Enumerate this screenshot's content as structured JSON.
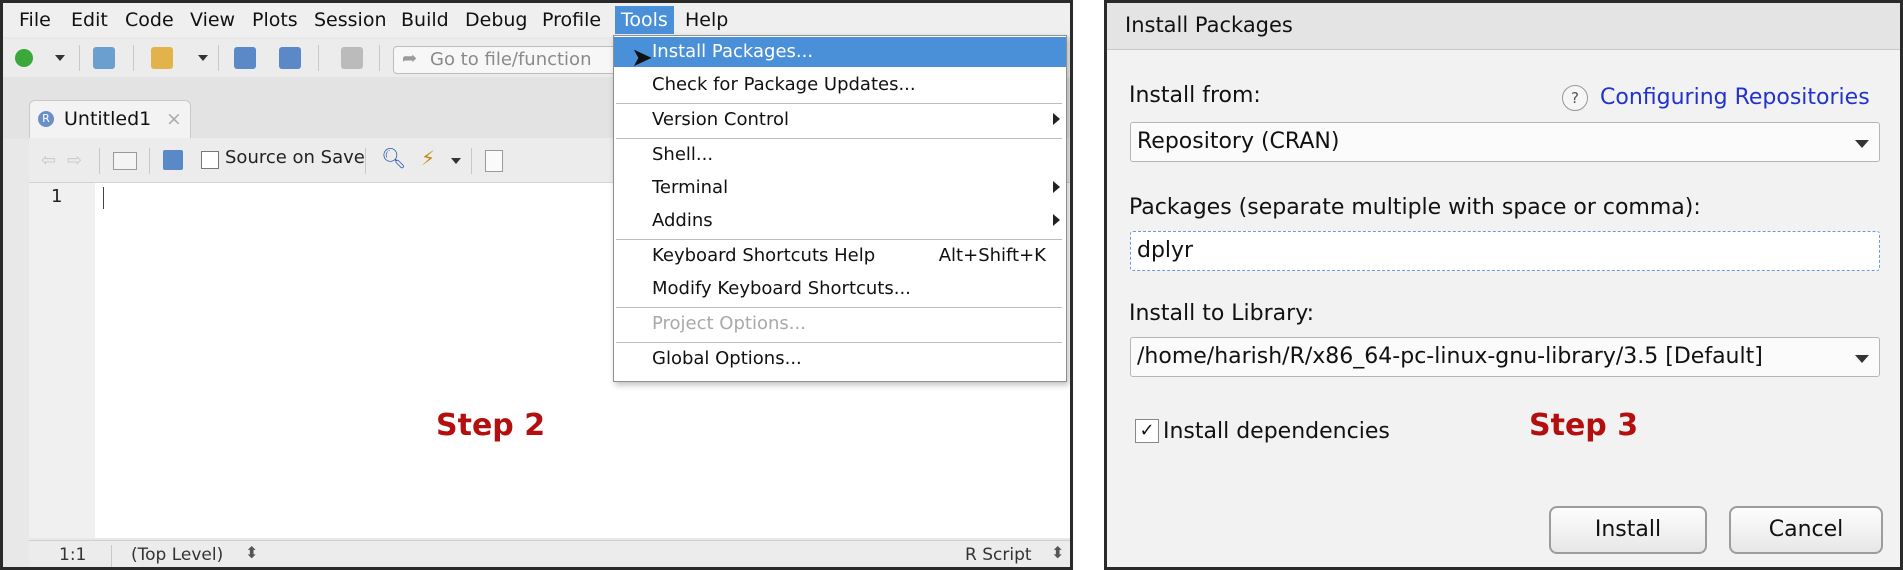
{
  "left": {
    "menubar": [
      "File",
      "Edit",
      "Code",
      "View",
      "Plots",
      "Session",
      "Build",
      "Debug",
      "Profile",
      "Tools",
      "Help"
    ],
    "goto_placeholder": "Go to file/function",
    "tab_label": "Untitled1",
    "source_on_save": "Source on Save",
    "line_number": "1",
    "status": {
      "position": "1:1",
      "scope": "(Top Level)",
      "filetype": "R Script"
    },
    "tools_menu": [
      {
        "label": "Install Packages...",
        "highlighted": true
      },
      {
        "label": "Check for Package Updates..."
      },
      {
        "label": "Version Control",
        "submenu": true
      },
      {
        "label": "Shell..."
      },
      {
        "label": "Terminal",
        "submenu": true
      },
      {
        "label": "Addins",
        "submenu": true
      },
      {
        "label": "Keyboard Shortcuts Help",
        "shortcut": "Alt+Shift+K"
      },
      {
        "label": "Modify Keyboard Shortcuts..."
      },
      {
        "label": "Project Options...",
        "disabled": true
      },
      {
        "label": "Global Options..."
      }
    ],
    "step_label": "Step 2"
  },
  "right": {
    "title": "Install Packages",
    "install_from_label": "Install from:",
    "help_link": "Configuring Repositories",
    "install_from_value": "Repository (CRAN)",
    "packages_label": "Packages (separate multiple with space or comma):",
    "packages_value": "dplyr",
    "library_label": "Install to Library:",
    "library_value": "/home/harish/R/x86_64-pc-linux-gnu-library/3.5 [Default]",
    "dependencies_label": "Install dependencies",
    "dependencies_checked": true,
    "install_button": "Install",
    "cancel_button": "Cancel",
    "step_label": "Step 3"
  },
  "colors": {
    "step": "#b30f0f",
    "highlight": "#4a90d9",
    "link": "#2233cc"
  }
}
